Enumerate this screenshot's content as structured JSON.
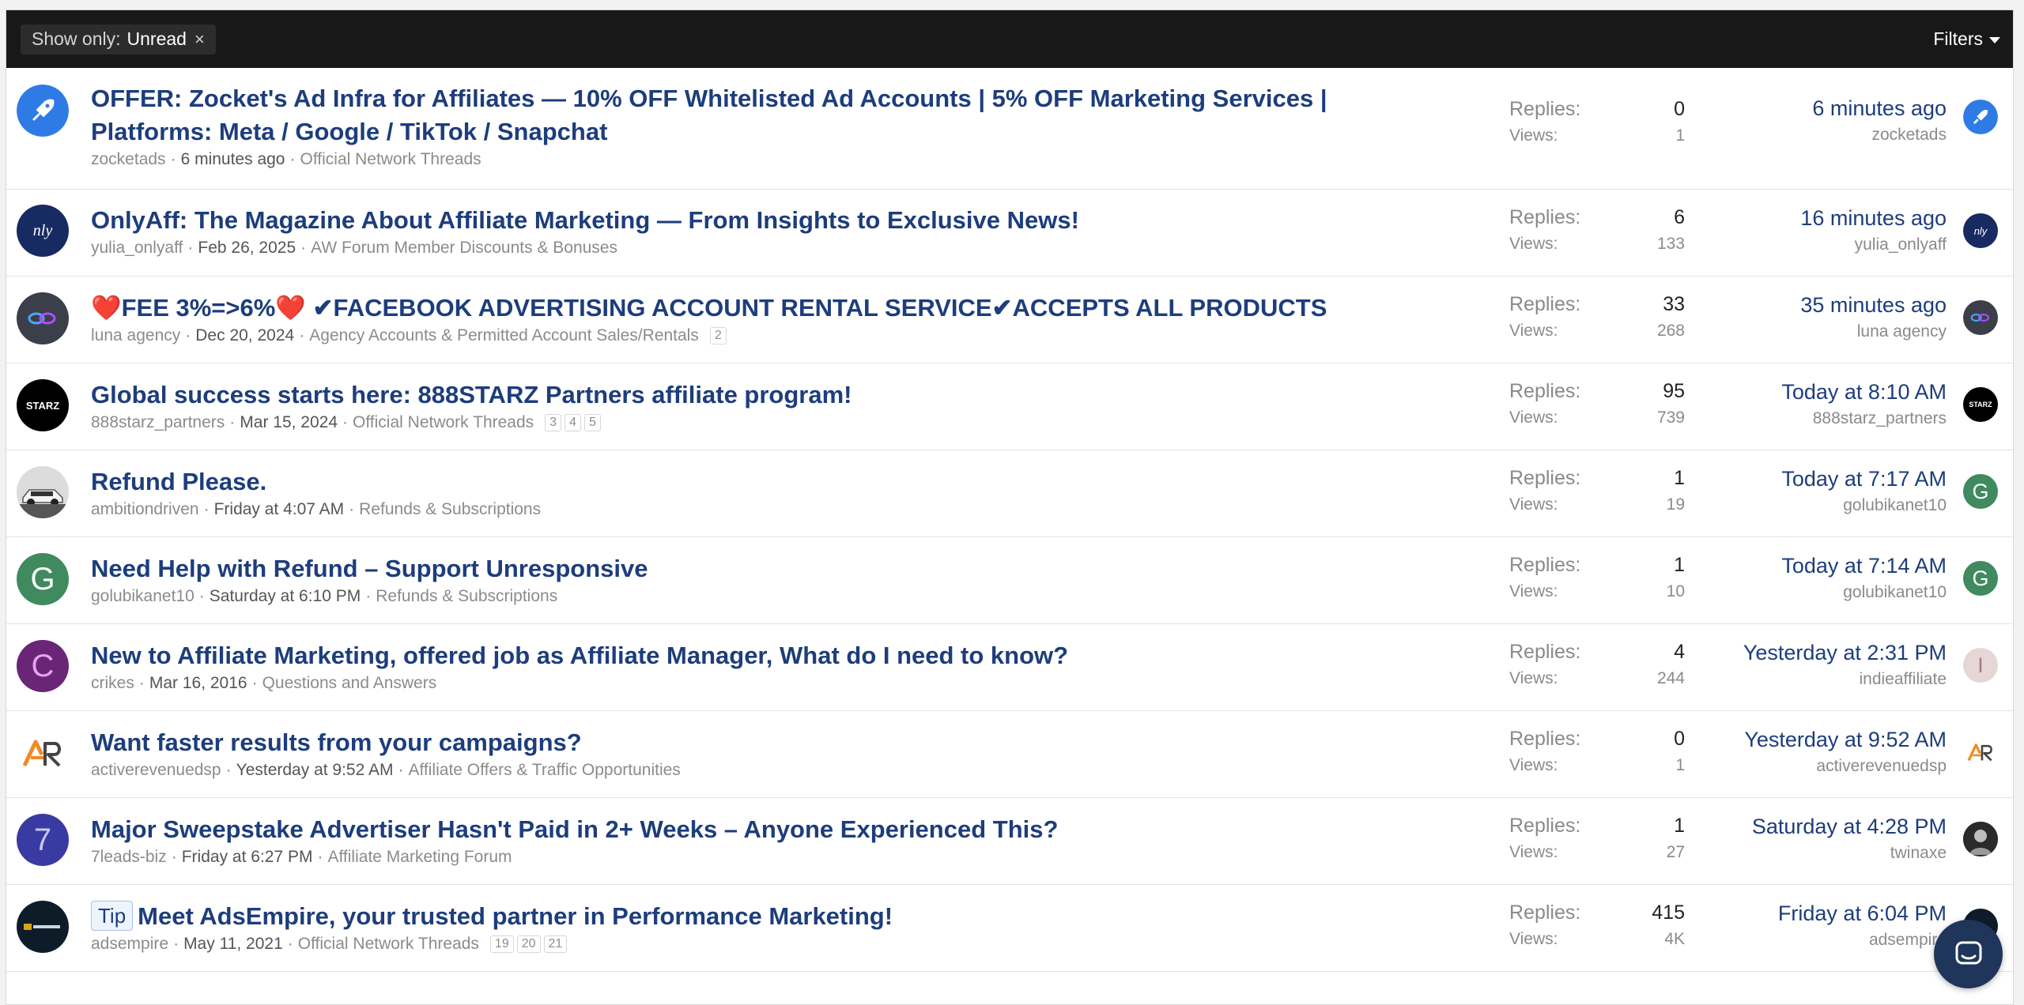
{
  "filterbar": {
    "chip_label": "Show only:",
    "chip_value": "Unread",
    "chip_close": "×",
    "filters_label": "Filters"
  },
  "threads": [
    {
      "avatar_icon": "rocket-icon",
      "title": "OFFER: Zocket's Ad Infra for Affiliates — 10% OFF Whitelisted Ad Accounts | 5% OFF Marketing Services | Platforms: Meta / Google / TikTok / Snapchat",
      "author": "zocketads",
      "date": "6 minutes ago",
      "forum": "Official Network Threads",
      "replies_label": "Replies:",
      "replies": "0",
      "views_label": "Views:",
      "views": "1",
      "last_time": "6 minutes ago",
      "last_user": "zocketads"
    },
    {
      "avatar_icon": "onlyaff-logo-icon",
      "avatar_text": "nly",
      "title": "OnlyAff: The Magazine About Affiliate Marketing — From Insights to Exclusive News!",
      "author": "yulia_onlyaff",
      "date": "Feb 26, 2025",
      "forum": "AW Forum Member Discounts & Bonuses",
      "replies_label": "Replies:",
      "replies": "6",
      "views_label": "Views:",
      "views": "133",
      "last_time": "16 minutes ago",
      "last_user": "yulia_onlyaff"
    },
    {
      "avatar_icon": "luna-logo-icon",
      "title": "❤️FEE 3%=>6%❤️ ✔FACEBOOK ADVERTISING ACCOUNT RENTAL SERVICE✔ACCEPTS ALL PRODUCTS",
      "author": "luna agency",
      "date": "Dec 20, 2024",
      "forum": "Agency Accounts & Permitted Account Sales/Rentals",
      "pages": [
        "2"
      ],
      "replies_label": "Replies:",
      "replies": "33",
      "views_label": "Views:",
      "views": "268",
      "last_time": "35 minutes ago",
      "last_user": "luna agency"
    },
    {
      "avatar_icon": "888starz-logo-icon",
      "avatar_text": "STARZ",
      "title": "Global success starts here: 888STARZ Partners affiliate program!",
      "author": "888starz_partners",
      "date": "Mar 15, 2024",
      "forum": "Official Network Threads",
      "pages": [
        "3",
        "4",
        "5"
      ],
      "replies_label": "Replies:",
      "replies": "95",
      "views_label": "Views:",
      "views": "739",
      "last_time": "Today at 8:10 AM",
      "last_user": "888starz_partners"
    },
    {
      "avatar_icon": "car-photo-icon",
      "title": "Refund Please.",
      "author": "ambitiondriven",
      "date": "Friday at 4:07 AM",
      "forum": "Refunds & Subscriptions",
      "replies_label": "Replies:",
      "replies": "1",
      "views_label": "Views:",
      "views": "19",
      "last_time": "Today at 7:17 AM",
      "last_user": "golubikanet10",
      "last_letter": "G"
    },
    {
      "avatar_letter": "G",
      "title": "Need Help with Refund – Support Unresponsive",
      "author": "golubikanet10",
      "date": "Saturday at 6:10 PM",
      "forum": "Refunds & Subscriptions",
      "replies_label": "Replies:",
      "replies": "1",
      "views_label": "Views:",
      "views": "10",
      "last_time": "Today at 7:14 AM",
      "last_user": "golubikanet10",
      "last_letter": "G"
    },
    {
      "avatar_letter": "C",
      "title": "New to Affiliate Marketing, offered job as Affiliate Manager, What do I need to know?",
      "author": "crikes",
      "date": "Mar 16, 2016",
      "forum": "Questions and Answers",
      "replies_label": "Replies:",
      "replies": "4",
      "views_label": "Views:",
      "views": "244",
      "last_time": "Yesterday at 2:31 PM",
      "last_user": "indieaffiliate",
      "last_letter": "I"
    },
    {
      "avatar_icon": "activerevenue-logo-icon",
      "title": "Want faster results from your campaigns?",
      "author": "activerevenuedsp",
      "date": "Yesterday at 9:52 AM",
      "forum": "Affiliate Offers & Traffic Opportunities",
      "replies_label": "Replies:",
      "replies": "0",
      "views_label": "Views:",
      "views": "1",
      "last_time": "Yesterday at 9:52 AM",
      "last_user": "activerevenuedsp"
    },
    {
      "avatar_letter": "7",
      "title": "Major Sweepstake Advertiser Hasn't Paid in 2+ Weeks – Anyone Experienced This?",
      "author": "7leads-biz",
      "date": "Friday at 6:27 PM",
      "forum": "Affiliate Marketing Forum",
      "replies_label": "Replies:",
      "replies": "1",
      "views_label": "Views:",
      "views": "27",
      "last_time": "Saturday at 4:28 PM",
      "last_user": "twinaxe"
    },
    {
      "avatar_icon": "adsempire-logo-icon",
      "prefix": "Tip",
      "title": "Meet AdsEmpire, your trusted partner in Performance Marketing!",
      "author": "adsempire",
      "date": "May 11, 2021",
      "forum": "Official Network Threads",
      "pages": [
        "19",
        "20",
        "21"
      ],
      "replies_label": "Replies:",
      "replies": "415",
      "views_label": "Views:",
      "views": "4K",
      "last_time": "Friday at 6:04 PM",
      "last_user": "adsempire"
    }
  ],
  "colors": {
    "link": "#1d3d7c",
    "bar": "#181818",
    "green_avatar": "#3f8a5e",
    "purple_avatar": "#6a2577",
    "blue_avatar": "#3a3aa3",
    "chat_button": "#20355a"
  },
  "chat_icon": "chat-bubble-icon"
}
